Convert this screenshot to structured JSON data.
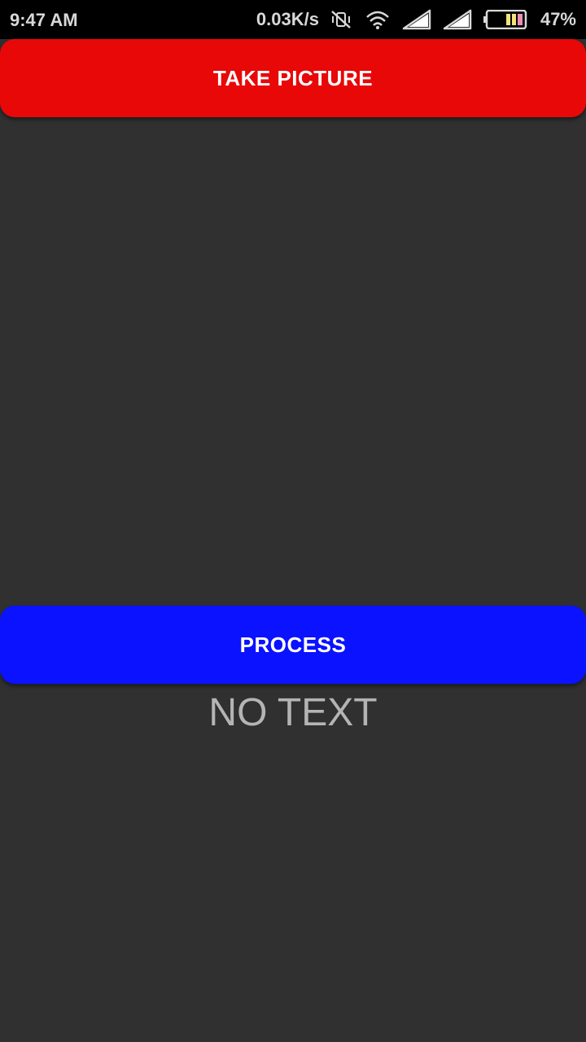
{
  "status_bar": {
    "time": "9:47 AM",
    "network_speed": "0.03K/s",
    "battery_percent": "47%",
    "icons": [
      "mute-vibrate-icon",
      "wifi-icon",
      "signal-icon",
      "signal-icon",
      "battery-icon"
    ]
  },
  "main": {
    "take_picture_label": "TAKE PICTURE",
    "process_label": "PROCESS",
    "result_text": "NO TEXT"
  },
  "colors": {
    "take_picture_button": "#e80808",
    "process_button": "#0a12ff",
    "background": "#303030",
    "status_bar": "#000000",
    "result_text": "#b4b4b4"
  }
}
